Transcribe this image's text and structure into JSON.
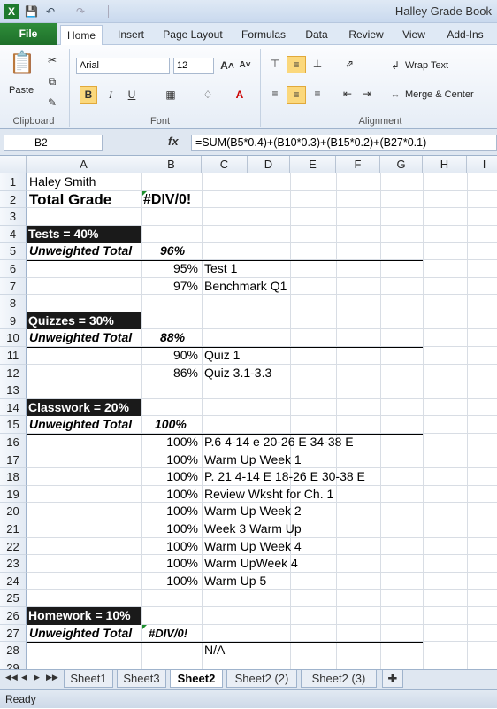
{
  "window": {
    "title": "Halley Grade Book"
  },
  "tabs": [
    "File",
    "Home",
    "Insert",
    "Page Layout",
    "Formulas",
    "Data",
    "Review",
    "View",
    "Add-Ins"
  ],
  "ribbon": {
    "paste_label": "Paste",
    "clipboard_label": "Clipboard",
    "font_label": "Font",
    "alignment_label": "Alignment",
    "font_name": "Arial",
    "font_size": "12",
    "wrap_text": "Wrap Text",
    "merge_center": "Merge & Center"
  },
  "formula_bar": {
    "name_box": "B2",
    "fx": "fx",
    "formula": "=SUM(B5*0.4)+(B10*0.3)+(B15*0.2)+(B27*0.1)"
  },
  "columns": [
    "A",
    "B",
    "C",
    "D",
    "E",
    "F",
    "G",
    "H",
    "I"
  ],
  "rows": [
    "1",
    "2",
    "3",
    "4",
    "5",
    "6",
    "7",
    "8",
    "9",
    "10",
    "11",
    "12",
    "13",
    "14",
    "15",
    "16",
    "17",
    "18",
    "19",
    "20",
    "21",
    "22",
    "23",
    "24",
    "25",
    "26",
    "27",
    "28",
    "29"
  ],
  "cells": {
    "A1": "Haley Smith",
    "A2": "Total Grade",
    "B2": "#DIV/0!",
    "A4": "Tests = 40%",
    "A5": "Unweighted Total",
    "B5": "96%",
    "B6": "95%",
    "C6": "Test 1",
    "B7": "97%",
    "C7": "Benchmark Q1",
    "A9": "Quizzes = 30%",
    "A10": "Unweighted Total",
    "B10": "88%",
    "B11": "90%",
    "C11": "Quiz 1",
    "B12": "86%",
    "C12": "Quiz 3.1-3.3",
    "A14": "Classwork = 20%",
    "A15": "Unweighted Total",
    "B15": "100%",
    "B16": "100%",
    "C16": "P.6 4-14 e 20-26 E 34-38 E",
    "B17": "100%",
    "C17": "Warm Up Week 1",
    "B18": "100%",
    "C18": "P. 21 4-14 E 18-26 E 30-38 E",
    "B19": "100%",
    "C19": "Review Wksht for Ch. 1",
    "B20": "100%",
    "C20": "Warm Up Week 2",
    "B21": "100%",
    "C21": "Week 3 Warm Up",
    "B22": "100%",
    "C22": "Warm Up Week 4",
    "B23": "100%",
    "C23": "Warm UpWeek 4",
    "B24": "100%",
    "C24": "Warm Up 5",
    "A26": "Homework = 10%",
    "A27": "Unweighted Total",
    "B27": "#DIV/0!",
    "C28": "N/A"
  },
  "sheet_tabs": [
    "Sheet1",
    "Sheet3",
    "Sheet2",
    "Sheet2 (2)",
    "Sheet2 (3)"
  ],
  "active_sheet": "Sheet2",
  "status": "Ready",
  "colors": {
    "file_tab": "#1e6f2a",
    "section_fill": "#1a1a1a",
    "ribbon_bg": "#dfe9f5"
  }
}
